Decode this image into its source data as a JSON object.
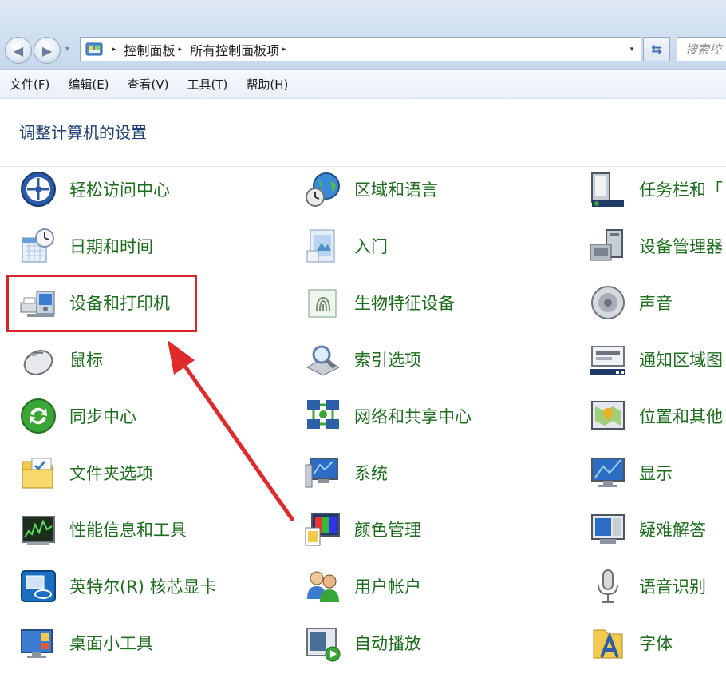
{
  "nav": {
    "back_glyph": "◀",
    "forward_glyph": "▶",
    "dropdown_glyph": "▾"
  },
  "address": {
    "separator": "▸",
    "crumbs": [
      "控制面板",
      "所有控制面板项"
    ],
    "dropdown_glyph": "▾"
  },
  "refresh_glyph": "⇆",
  "search": {
    "placeholder": "搜索控"
  },
  "menu": [
    "文件(F)",
    "编辑(E)",
    "查看(V)",
    "工具(T)",
    "帮助(H)"
  ],
  "page_heading": "调整计算机的设置",
  "columns": [
    [
      {
        "label": "轻松访问中心",
        "icon": "ease-of-access-icon"
      },
      {
        "label": "日期和时间",
        "icon": "date-time-icon"
      },
      {
        "label": "设备和打印机",
        "icon": "devices-printers-icon"
      },
      {
        "label": "鼠标",
        "icon": "mouse-icon"
      },
      {
        "label": "同步中心",
        "icon": "sync-center-icon"
      },
      {
        "label": "文件夹选项",
        "icon": "folder-options-icon"
      },
      {
        "label": "性能信息和工具",
        "icon": "performance-icon"
      },
      {
        "label": "英特尔(R) 核芯显卡",
        "icon": "intel-graphics-icon"
      },
      {
        "label": "桌面小工具",
        "icon": "desktop-gadgets-icon"
      }
    ],
    [
      {
        "label": "区域和语言",
        "icon": "region-language-icon"
      },
      {
        "label": "入门",
        "icon": "getting-started-icon"
      },
      {
        "label": "生物特征设备",
        "icon": "biometric-icon"
      },
      {
        "label": "索引选项",
        "icon": "indexing-icon"
      },
      {
        "label": "网络和共享中心",
        "icon": "network-sharing-icon"
      },
      {
        "label": "系统",
        "icon": "system-icon"
      },
      {
        "label": "颜色管理",
        "icon": "color-management-icon"
      },
      {
        "label": "用户帐户",
        "icon": "user-accounts-icon"
      },
      {
        "label": "自动播放",
        "icon": "autoplay-icon"
      }
    ],
    [
      {
        "label": "任务栏和「",
        "icon": "taskbar-icon"
      },
      {
        "label": "设备管理器",
        "icon": "device-manager-icon"
      },
      {
        "label": "声音",
        "icon": "sound-icon"
      },
      {
        "label": "通知区域图",
        "icon": "notification-area-icon"
      },
      {
        "label": "位置和其他",
        "icon": "location-icon"
      },
      {
        "label": "显示",
        "icon": "display-icon"
      },
      {
        "label": "疑难解答",
        "icon": "troubleshooting-icon"
      },
      {
        "label": "语音识别",
        "icon": "speech-recognition-icon"
      },
      {
        "label": "字体",
        "icon": "fonts-icon"
      }
    ]
  ],
  "colors": {
    "link_green": "#1b6e1b",
    "heading_blue": "#1e3f73",
    "highlight_red": "#d8262b"
  }
}
